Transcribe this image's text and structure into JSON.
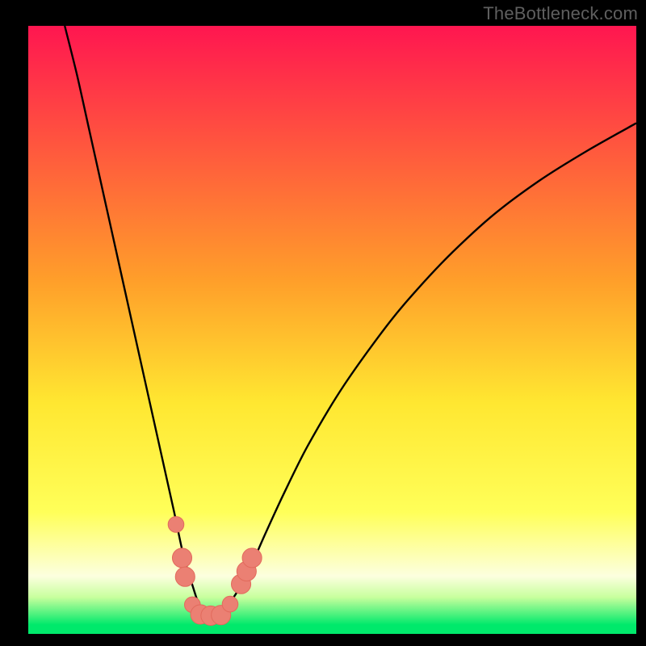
{
  "watermark": "TheBottleneck.com",
  "colors": {
    "black": "#000000",
    "curve": "#000000",
    "marker_fill": "#eb8073",
    "marker_stroke": "#e26a5c",
    "grad_top": "#ff1650",
    "grad_mid1": "#ff9f2a",
    "grad_mid2": "#ffe731",
    "grad_bottom_yellow": "#ffff59",
    "grad_pale": "#fcffdf",
    "grad_green_pale": "#c7ff9d",
    "grad_green": "#00e96b"
  },
  "chart_data": {
    "type": "line",
    "title": "",
    "xlabel": "",
    "ylabel": "",
    "xlim": [
      0,
      100
    ],
    "ylim": [
      0,
      100
    ],
    "series": [
      {
        "name": "bottleneck-curve",
        "x": [
          6,
          8,
          10,
          12,
          14,
          16,
          18,
          20,
          22,
          24,
          25.5,
          27,
          28,
          29,
          30,
          31,
          33,
          35,
          37,
          39,
          42,
          46,
          52,
          60,
          68,
          76,
          84,
          92,
          100
        ],
        "y": [
          100,
          92,
          83,
          74,
          65,
          56,
          47,
          38,
          29,
          20,
          13,
          8,
          5,
          3.5,
          3,
          3.4,
          5,
          8,
          12,
          16.5,
          23,
          31,
          41,
          52,
          61,
          68.5,
          74.5,
          79.5,
          84
        ]
      }
    ],
    "markers": [
      {
        "x": 24.3,
        "y": 18,
        "r": 1.3
      },
      {
        "x": 25.3,
        "y": 12.5,
        "r": 1.6
      },
      {
        "x": 25.8,
        "y": 9.4,
        "r": 1.6
      },
      {
        "x": 27.0,
        "y": 4.8,
        "r": 1.3
      },
      {
        "x": 28.3,
        "y": 3.2,
        "r": 1.6
      },
      {
        "x": 30.0,
        "y": 3.0,
        "r": 1.6
      },
      {
        "x": 31.7,
        "y": 3.1,
        "r": 1.6
      },
      {
        "x": 33.2,
        "y": 4.9,
        "r": 1.3
      },
      {
        "x": 35.0,
        "y": 8.2,
        "r": 1.6
      },
      {
        "x": 35.9,
        "y": 10.3,
        "r": 1.6
      },
      {
        "x": 36.8,
        "y": 12.5,
        "r": 1.6
      }
    ],
    "gradient_stops": [
      {
        "offset": 0.0,
        "key": "grad_top"
      },
      {
        "offset": 0.42,
        "key": "grad_mid1"
      },
      {
        "offset": 0.62,
        "key": "grad_mid2"
      },
      {
        "offset": 0.8,
        "key": "grad_bottom_yellow"
      },
      {
        "offset": 0.905,
        "key": "grad_pale"
      },
      {
        "offset": 0.94,
        "key": "grad_green_pale"
      },
      {
        "offset": 0.985,
        "key": "grad_green"
      }
    ]
  }
}
